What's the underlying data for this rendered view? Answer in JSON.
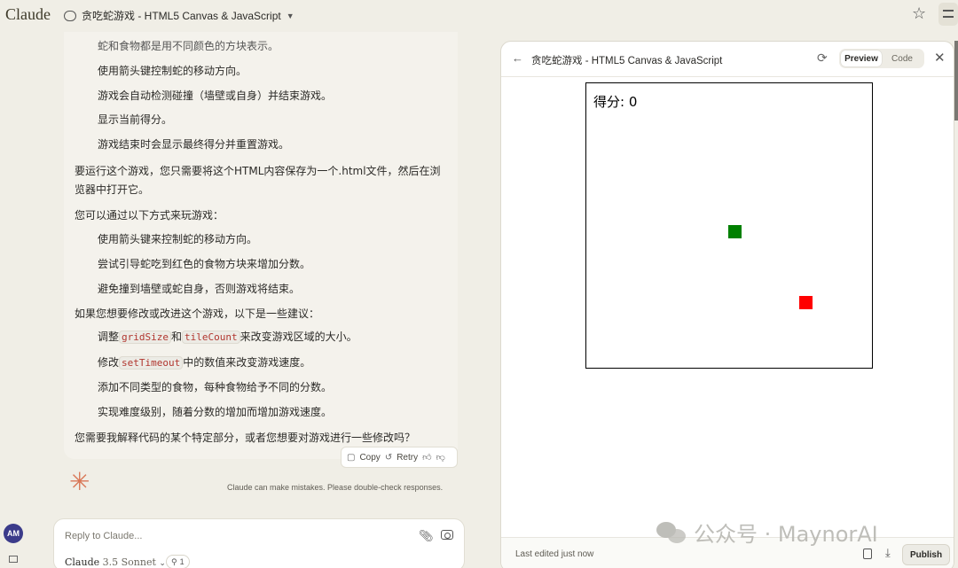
{
  "app": {
    "brand": "Claude"
  },
  "header": {
    "chat_title": "贪吃蛇游戏 - HTML5 Canvas & JavaScript"
  },
  "chat": {
    "lines": [
      "蛇和食物都是用不同颜色的方块表示。",
      "使用箭头键控制蛇的移动方向。",
      "游戏会自动检测碰撞（墙壁或自身）并结束游戏。",
      "显示当前得分。",
      "游戏结束时会显示最终得分并重置游戏。",
      "要运行这个游戏，您只需要将这个HTML内容保存为一个.html文件，然后在浏",
      "览器中打开它。",
      "您可以通过以下方式来玩游戏：",
      "使用箭头键来控制蛇的移动方向。",
      "尝试引导蛇吃到红色的食物方块来增加分数。",
      "避免撞到墙壁或蛇自身，否则游戏将结束。",
      "如果您想要修改或改进这个游戏，以下是一些建议：",
      "添加不同类型的食物，每种食物给予不同的分数。",
      "实现难度级别，随着分数的增加而增加游戏速度。",
      "您需要我解释代码的某个特定部分，或者您想要对游戏进行一些修改吗？"
    ],
    "suggestion1": {
      "prefix": "调整",
      "code1": "gridSize",
      "mid": "和",
      "code2": "tileCount",
      "suffix": "来改变游戏区域的大小。"
    },
    "suggestion2": {
      "prefix": "修改",
      "code": "setTimeout",
      "suffix": "中的数值来改变游戏速度。"
    },
    "actions": {
      "copy": "Copy",
      "retry": "Retry"
    },
    "disclaimer": "Claude can make mistakes. Please double-check responses."
  },
  "user": {
    "initials": "AM"
  },
  "composer": {
    "placeholder": "Reply to Claude...",
    "model": "Claude",
    "model_version": "3.5 Sonnet",
    "badge_count": "1"
  },
  "artifact": {
    "title": "贪吃蛇游戏 - HTML5 Canvas & JavaScript",
    "tabs": {
      "preview": "Preview",
      "code": "Code"
    },
    "score_label": "得分: 0",
    "footer_status": "Last edited just now",
    "publish": "Publish"
  },
  "game": {
    "snake_color": "#008000",
    "food_color": "#ff0000"
  },
  "watermark": "公众号 · MaynorAI"
}
